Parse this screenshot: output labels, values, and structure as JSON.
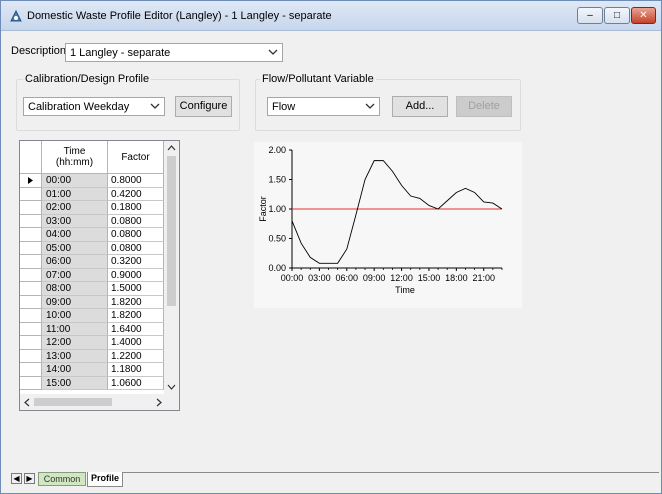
{
  "window": {
    "title": "Domestic Waste Profile Editor (Langley) - 1 Langley - separate",
    "minimize_glyph": "–",
    "maximize_glyph": "□",
    "close_glyph": "✕"
  },
  "description": {
    "label": "Description",
    "value": "1 Langley - separate"
  },
  "calibration_group": {
    "title": "Calibration/Design Profile",
    "select_value": "Calibration Weekday",
    "configure_label": "Configure"
  },
  "flow_group": {
    "title": "Flow/Pollutant Variable",
    "select_value": "Flow",
    "add_label": "Add...",
    "delete_label": "Delete"
  },
  "grid": {
    "time_header": "Time",
    "time_header_sub": "(hh:mm)",
    "factor_header": "Factor",
    "rows": [
      {
        "time": "00:00",
        "factor": "0.8000"
      },
      {
        "time": "01:00",
        "factor": "0.4200"
      },
      {
        "time": "02:00",
        "factor": "0.1800"
      },
      {
        "time": "03:00",
        "factor": "0.0800"
      },
      {
        "time": "04:00",
        "factor": "0.0800"
      },
      {
        "time": "05:00",
        "factor": "0.0800"
      },
      {
        "time": "06:00",
        "factor": "0.3200"
      },
      {
        "time": "07:00",
        "factor": "0.9000"
      },
      {
        "time": "08:00",
        "factor": "1.5000"
      },
      {
        "time": "09:00",
        "factor": "1.8200"
      },
      {
        "time": "10:00",
        "factor": "1.8200"
      },
      {
        "time": "11:00",
        "factor": "1.6400"
      },
      {
        "time": "12:00",
        "factor": "1.4000"
      },
      {
        "time": "13:00",
        "factor": "1.2200"
      },
      {
        "time": "14:00",
        "factor": "1.1800"
      },
      {
        "time": "15:00",
        "factor": "1.0600"
      }
    ]
  },
  "chart_data": {
    "type": "line",
    "xlabel": "Time",
    "ylabel": "Factor",
    "x_ticks": [
      "00:00",
      "03:00",
      "06:00",
      "09:00",
      "12:00",
      "15:00",
      "18:00",
      "21:00"
    ],
    "y_ticks": [
      "0.00",
      "0.50",
      "1.00",
      "1.50",
      "2.00"
    ],
    "xlim": [
      0,
      23
    ],
    "ylim": [
      0,
      2
    ],
    "x": [
      0,
      1,
      2,
      3,
      4,
      5,
      6,
      7,
      8,
      9,
      10,
      11,
      12,
      13,
      14,
      15,
      16,
      17,
      18,
      19,
      20,
      21,
      22,
      23
    ],
    "values": [
      0.8,
      0.42,
      0.18,
      0.08,
      0.08,
      0.08,
      0.32,
      0.9,
      1.5,
      1.82,
      1.82,
      1.64,
      1.4,
      1.22,
      1.18,
      1.06,
      1.0,
      1.14,
      1.28,
      1.35,
      1.28,
      1.12,
      1.1,
      1.0
    ],
    "reference_line": 1.0,
    "line_color": "#000000",
    "reference_color": "#e03030"
  },
  "tabs": [
    {
      "label": "Common"
    },
    {
      "label": "Profile"
    }
  ]
}
